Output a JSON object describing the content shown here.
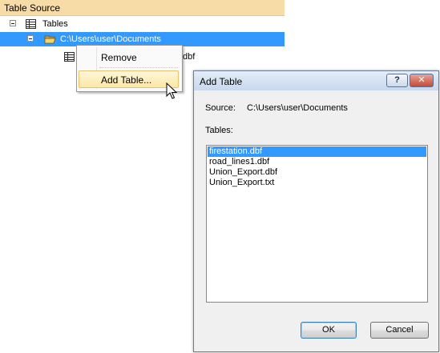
{
  "panel": {
    "header": "Table Source",
    "tree": {
      "root_label": "Tables",
      "folder_label": "C:\\Users\\user\\Documents",
      "file_label_visible": "dbf"
    }
  },
  "context_menu": {
    "items": [
      {
        "label": "Remove"
      },
      {
        "label": "Add Table..."
      }
    ]
  },
  "dialog": {
    "title": "Add Table",
    "help_button": "?",
    "close_button": "✕",
    "source_label": "Source:",
    "source_value": "C:\\Users\\user\\Documents",
    "tables_label": "Tables:",
    "tables": [
      {
        "name": "firestation.dbf",
        "selected": true
      },
      {
        "name": "road_lines1.dbf",
        "selected": false
      },
      {
        "name": "Union_Export.dbf",
        "selected": false
      },
      {
        "name": "Union_Export.txt",
        "selected": false
      }
    ],
    "ok_label": "OK",
    "cancel_label": "Cancel"
  },
  "colors": {
    "header_bg": "#f8dca7",
    "selection": "#3399ff",
    "menu_hover": "#fde7a4"
  },
  "icons": {
    "tables_root": "table-icon",
    "folder": "open-folder-icon",
    "file": "table-icon",
    "cursor": "mouse-pointer-icon"
  }
}
